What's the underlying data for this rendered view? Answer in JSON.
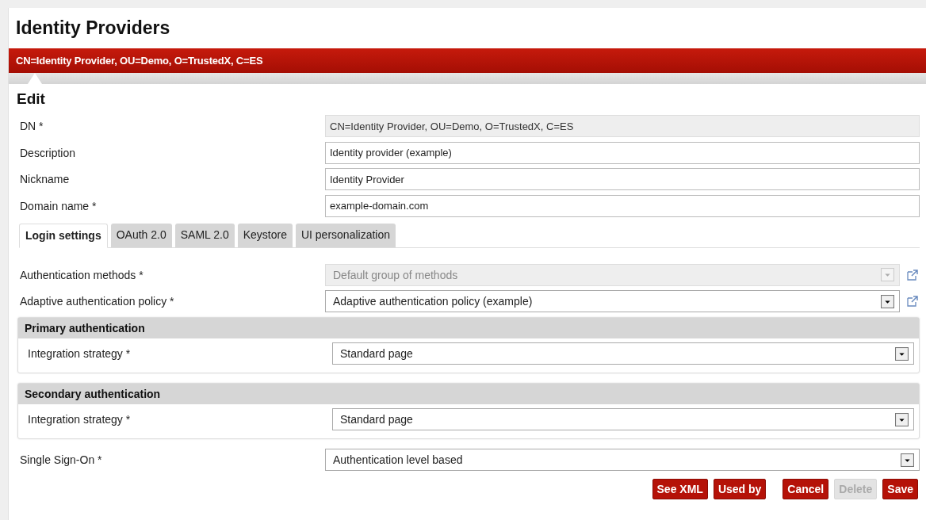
{
  "page_title": "Identity Providers",
  "banner": "CN=Identity Provider, OU=Demo, O=TrustedX, C=ES",
  "section_title": "Edit",
  "fields": [
    {
      "label": "DN *",
      "value": "CN=Identity Provider, OU=Demo, O=TrustedX, C=ES",
      "disabled": true
    },
    {
      "label": "Description",
      "value": "Identity provider (example)",
      "disabled": false
    },
    {
      "label": "Nickname",
      "value": "Identity Provider",
      "disabled": false
    },
    {
      "label": "Domain name *",
      "value": "example-domain.com",
      "disabled": false
    }
  ],
  "tabs": [
    {
      "label": "Login settings",
      "selected": true
    },
    {
      "label": "OAuth 2.0",
      "selected": false
    },
    {
      "label": "SAML 2.0",
      "selected": false
    },
    {
      "label": "Keystore",
      "selected": false
    },
    {
      "label": "UI personalization",
      "selected": false
    }
  ],
  "login_settings": [
    {
      "label": "Authentication methods *",
      "value": "Default group of methods",
      "disabled": true
    },
    {
      "label": "Adaptive authentication policy *",
      "value": "Adaptive authentication policy (example)",
      "disabled": false
    }
  ],
  "groups": [
    {
      "title": "Primary authentication",
      "label": "Integration strategy *",
      "value": "Standard page"
    },
    {
      "title": "Secondary authentication",
      "label": "Integration strategy *",
      "value": "Standard page"
    }
  ],
  "single_sign_on": {
    "label": "Single Sign-On *",
    "value": "Authentication level based"
  },
  "buttons": [
    {
      "label": "See XML",
      "disabled": false
    },
    {
      "label": "Used by",
      "disabled": false
    },
    {
      "label": "Cancel",
      "disabled": false
    },
    {
      "label": "Delete",
      "disabled": true
    },
    {
      "label": "Save",
      "disabled": false
    }
  ]
}
